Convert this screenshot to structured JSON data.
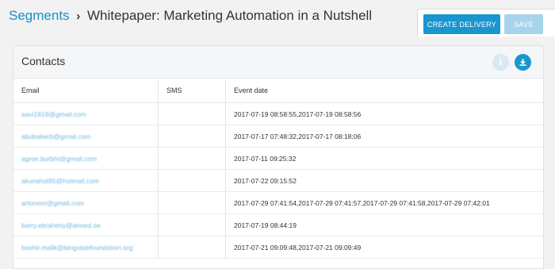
{
  "breadcrumb": {
    "parent": "Segments",
    "separator": "›",
    "title": "Whitepaper: Marketing Automation in a Nutshell"
  },
  "actions": {
    "create_delivery": "CREATE DELIVERY",
    "save": "SAVE"
  },
  "panel": {
    "title": "Contacts",
    "info_icon": "info-icon",
    "download_icon": "download-icon"
  },
  "table": {
    "columns": [
      "Email",
      "SMS",
      "Event date"
    ],
    "rows": [
      {
        "email": "aavi1818@gmail.com",
        "sms": "",
        "event_date": "2017-07-19 08:58:55,2017-07-19 08:58:56"
      },
      {
        "email": "abubakerb@gmail.com",
        "sms": "",
        "event_date": "2017-07-17 07:48:32,2017-07-17 08:18:06"
      },
      {
        "email": "agron.burbhi@gmail.com",
        "sms": "",
        "event_date": "2017-07-11 09:25:32"
      },
      {
        "email": "akunshol85@hotmail.com",
        "sms": "",
        "event_date": "2017-07-22 09:15:52"
      },
      {
        "email": "artonoor@gmail.com",
        "sms": "",
        "event_date": "2017-07-29 07:41:54,2017-07-29 07:41:57,2017-07-29 07:41:58,2017-07-29 07:42:01"
      },
      {
        "email": "barry.ebrahimy@ahoed.se",
        "sms": "",
        "event_date": "2017-07-19 08:44:19"
      },
      {
        "email": "bashir.malik@bingutabfoundation.org",
        "sms": "",
        "event_date": "2017-07-21 09:09:48,2017-07-21 09:09:49"
      }
    ]
  },
  "colors": {
    "accent": "#1a96cf",
    "accent_disabled": "#a6d5eb",
    "link": "#1b8fc5"
  }
}
